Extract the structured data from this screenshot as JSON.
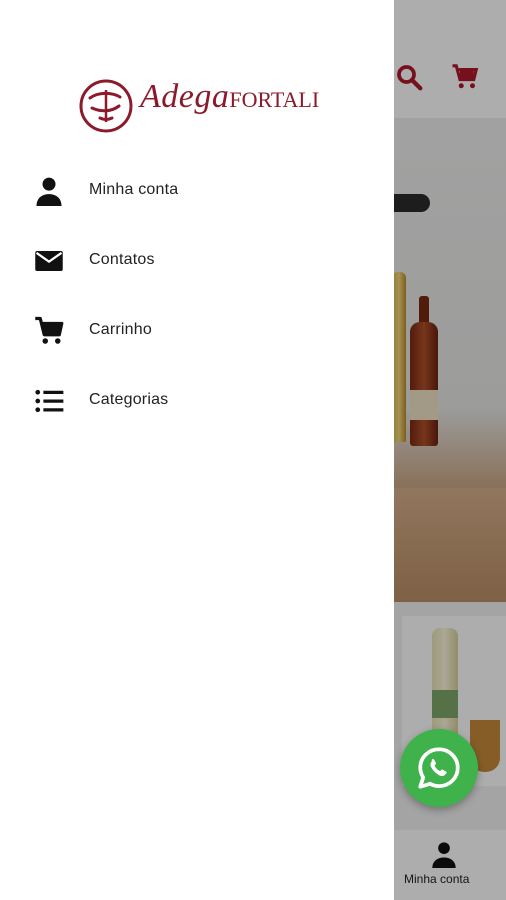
{
  "app": {
    "bottom_nav": {
      "account_label": "Minha conta"
    }
  },
  "drawer": {
    "logo": {
      "script": "Adega",
      "brand": "FORTALI"
    },
    "items": [
      {
        "label": "Minha conta",
        "icon": "person-icon"
      },
      {
        "label": "Contatos",
        "icon": "envelope-icon"
      },
      {
        "label": "Carrinho",
        "icon": "cart-icon"
      },
      {
        "label": "Categorias",
        "icon": "list-icon"
      }
    ]
  },
  "colors": {
    "brand": "#8b1a2c",
    "whatsapp": "#3fb24b",
    "drawer_bg": "#ffffff",
    "scrim": "rgba(0,0,0,0.32)"
  }
}
